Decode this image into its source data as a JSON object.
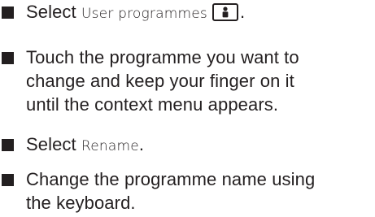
{
  "steps": [
    {
      "prefix": "Select ",
      "ui_term": "User programmes",
      "icon": "user-icon",
      "suffix": "."
    },
    {
      "line1": "Touch the programme you want to",
      "line2": "change and keep your finger on it",
      "line3": "until the context menu appears."
    },
    {
      "prefix": "Select ",
      "ui_term": "Rename",
      "suffix": "."
    },
    {
      "line1": "Change the programme name using",
      "line2": "the keyboard."
    }
  ],
  "colors": {
    "text": "#231f20",
    "background": "#ffffff"
  }
}
